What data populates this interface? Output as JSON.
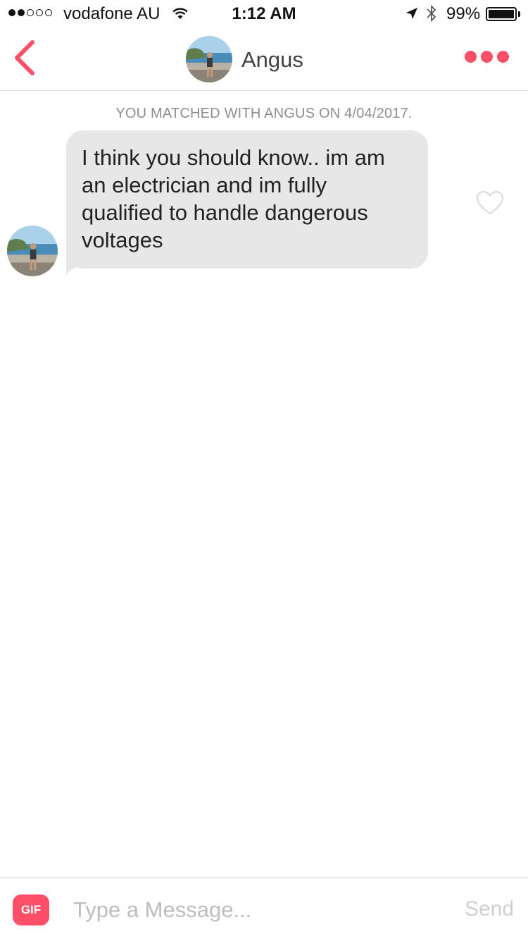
{
  "status_bar": {
    "carrier": "vodafone AU",
    "time": "1:12 AM",
    "battery_percent": "99%",
    "signal_bars_filled": 2,
    "signal_bars_total": 5,
    "battery_level": 0.99
  },
  "nav": {
    "name": "Angus",
    "back_icon": "chevron-left-icon",
    "more_icon": "more-dots-icon"
  },
  "conversation": {
    "match_text": "YOU MATCHED WITH ANGUS ON 4/04/2017.",
    "messages": [
      {
        "sender": "Angus",
        "text": "I think you should know.. im am an electrician and im fully qualified to handle dangerous voltages",
        "liked": false
      }
    ]
  },
  "input_bar": {
    "gif_label": "GIF",
    "placeholder": "Type a Message...",
    "value": "",
    "send_label": "Send"
  },
  "colors": {
    "accent": "#fd5068",
    "bubble": "#e7e7e7",
    "muted_text": "#8e8e8e"
  }
}
